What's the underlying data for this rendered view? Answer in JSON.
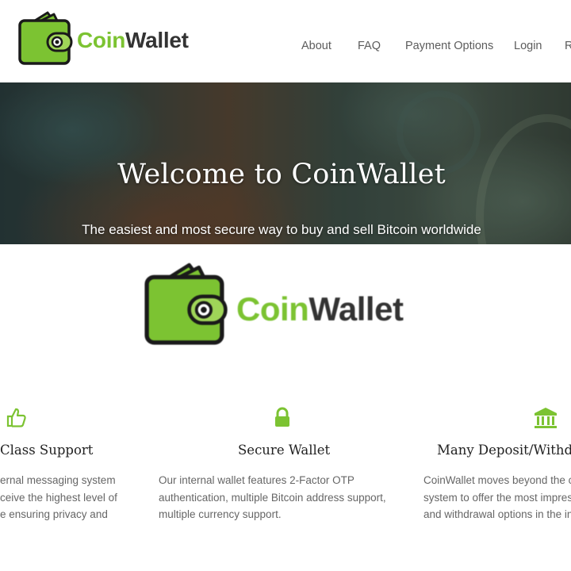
{
  "brand": {
    "coin": "Coin",
    "wallet": "Wallet"
  },
  "nav": {
    "items": [
      "About",
      "FAQ",
      "Payment Options",
      "Login",
      "R"
    ]
  },
  "hero": {
    "title": "Welcome to CoinWallet",
    "subtitle": "The easiest and most secure way to buy and sell Bitcoin worldwide"
  },
  "big_logo": {
    "coin": "Coin",
    "wallet": "Wallet"
  },
  "features": [
    {
      "icon": "thumbs-up-icon",
      "title": "Class Support",
      "lines": [
        "ernal messaging system",
        "ceive the highest level of",
        "e ensuring privacy and"
      ]
    },
    {
      "icon": "lock-icon",
      "title": "Secure Wallet",
      "lines": [
        "Our internal wallet features 2-Factor OTP",
        "authentication, multiple Bitcoin address support,",
        "multiple currency support."
      ]
    },
    {
      "icon": "bank-icon",
      "title": "Many Deposit/Withdr",
      "lines": [
        "CoinWallet moves beyond the c",
        "system to offer the most impres",
        "and withdrawal options in the in"
      ]
    }
  ],
  "colors": {
    "accent": "#7cc332",
    "dark": "#333333",
    "nav_text": "#5c5c5c"
  }
}
